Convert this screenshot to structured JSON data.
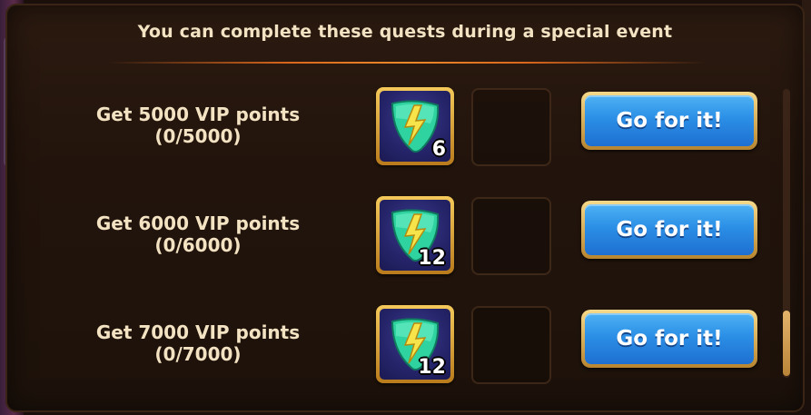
{
  "header": {
    "title": "You can complete these quests during a special event"
  },
  "quests": [
    {
      "label": "Get 5000 VIP points",
      "progress": "(0/5000)",
      "reward_icon": "energy-shield-icon",
      "reward_count": "6",
      "button": "Go for it!"
    },
    {
      "label": "Get 6000 VIP points",
      "progress": "(0/6000)",
      "reward_icon": "energy-shield-icon",
      "reward_count": "12",
      "button": "Go for it!"
    },
    {
      "label": "Get 7000 VIP points",
      "progress": "(0/7000)",
      "reward_icon": "energy-shield-icon",
      "reward_count": "12",
      "button": "Go for it!"
    }
  ],
  "scroll": {
    "position_fraction": 0.95
  },
  "colors": {
    "title_text": "#f3e3c3",
    "button_blue": "#2b8fe6",
    "frame_gold": "#d9a440",
    "divider_orange": "#f08a2a"
  }
}
